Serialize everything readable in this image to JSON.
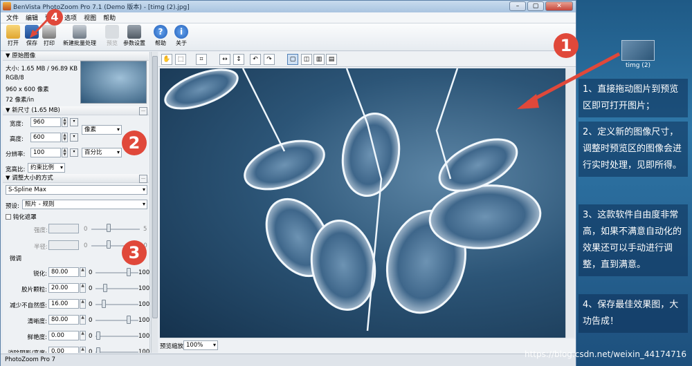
{
  "window": {
    "title": "BenVista PhotoZoom Pro 7.1 (Demo 版本) - [timg (2).jpg]",
    "buttons": [
      "–",
      "▢",
      "✕"
    ]
  },
  "menu": [
    "文件",
    "编辑",
    "预览",
    "选项",
    "视图",
    "帮助"
  ],
  "toolbar": {
    "open": "打开",
    "save": "保存",
    "print": "打印",
    "batch": "新建批量处理",
    "preview": "预览",
    "settings": "参数设置",
    "help": "帮助",
    "about": "关于"
  },
  "original": {
    "header": "原始图像",
    "size": "大小: 1.65 MB / 96.89 KB",
    "mode": "RGB/8",
    "dims": "960 x 600 像素",
    "res": "72 像素/in"
  },
  "newsize": {
    "header": "新尺寸 (1.65 MB)",
    "width_label": "宽度:",
    "width": "960",
    "height_label": "高度:",
    "height": "600",
    "res_label": "分辨率:",
    "res": "100",
    "unit1": "像素",
    "unit2": "百分比",
    "aspect_label": "宽高比:",
    "aspect": "约束比例"
  },
  "resize": {
    "header": "调整大小的方式",
    "method": "S-Spline Max",
    "preset_label": "预设:",
    "preset": "照片 - 规则"
  },
  "sharpen": {
    "header": "钝化遮罩",
    "strength": "强度:",
    "radius": "半径:",
    "min0": "0",
    "max5": "5",
    "max10": "10"
  },
  "fine": {
    "header": "微调",
    "rows": [
      {
        "label": "锐化:",
        "value": "80.00",
        "min": "0",
        "max": "100"
      },
      {
        "label": "胶片颗粒:",
        "value": "20.00",
        "min": "0",
        "max": "100"
      },
      {
        "label": "减少不自然感:",
        "value": "16.00",
        "min": "0",
        "max": "100"
      },
      {
        "label": "清晰度:",
        "value": "80.00",
        "min": "0",
        "max": "100"
      },
      {
        "label": "鲜艳度:",
        "value": "0.00",
        "min": "0",
        "max": "100"
      },
      {
        "label": "消除阴影/高度:",
        "value": "0.00",
        "min": "0",
        "max": "100"
      }
    ]
  },
  "zoom": {
    "label": "预览缩放:",
    "value": "100%"
  },
  "status": "PhotoZoom Pro 7",
  "annotations": [
    "1",
    "2",
    "3",
    "4"
  ],
  "desktop_icon": "timg (2)",
  "notes": [
    "1、直接拖动图片到预览区即可打开图片；",
    "2、定义新的图像尺寸，调整时预览区的图像会进行实时处理，见即所得。",
    "3、这款软件自由度非常高，如果不满意自动化的效果还可以手动进行调整，直到满意。",
    "4、保存最佳效果图，大功告成！"
  ],
  "watermark": "https://blog.csdn.net/weixin_44174716"
}
